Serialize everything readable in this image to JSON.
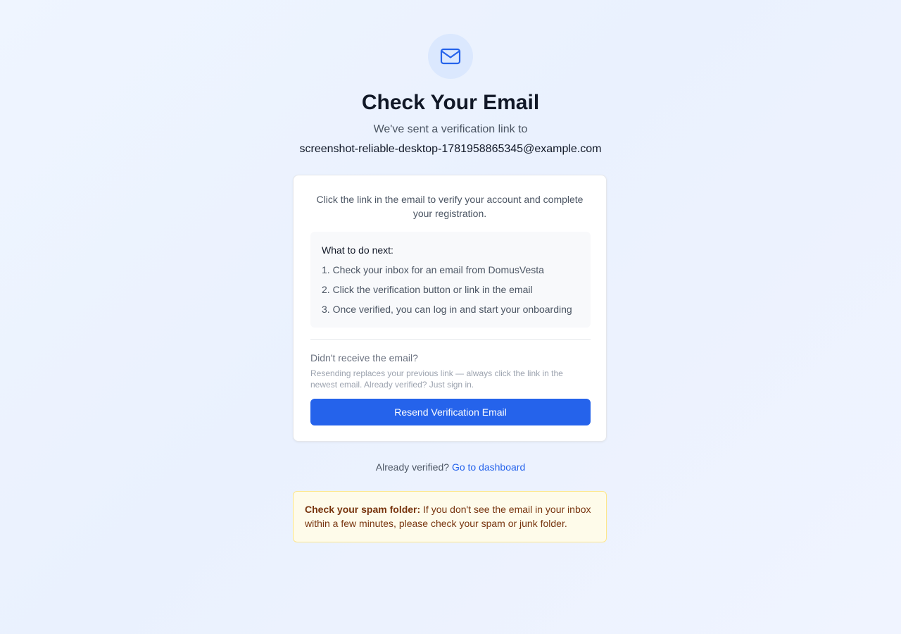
{
  "header": {
    "icon": "mail-icon",
    "title": "Check Your Email",
    "subtitle": "We've sent a verification link to",
    "email": "screenshot-reliable-desktop-1781958865345@example.com"
  },
  "card": {
    "intro": "Click the link in the email to verify your account and complete your registration.",
    "steps_title": "What to do next:",
    "steps": [
      "1. Check your inbox for an email from DomusVesta",
      "2. Click the verification button or link in the email",
      "3. Once verified, you can log in and start your onboarding"
    ],
    "resend_question": "Didn't receive the email?",
    "resend_note": "Resending replaces your previous link — always click the link in the newest email. Already verified? Just sign in.",
    "resend_button": "Resend Verification Email"
  },
  "footer": {
    "verified_prompt": "Already verified?",
    "dashboard_link": "Go to dashboard"
  },
  "spam_notice": {
    "label": "Check your spam folder:",
    "text": "If you don't see the email in your inbox within a few minutes, please check your spam or junk folder."
  },
  "colors": {
    "accent": "#2563eb",
    "icon_bg": "#dbe8fe",
    "warning_bg": "#fefbea",
    "warning_border": "#fde68a",
    "warning_text": "#78350f"
  }
}
